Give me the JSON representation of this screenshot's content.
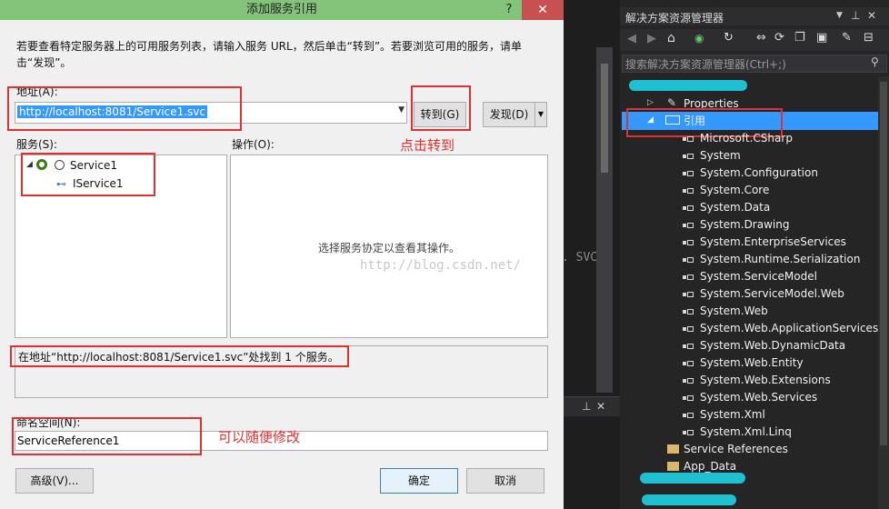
{
  "dialog": {
    "title": "添加服务引用",
    "help": "?",
    "close": "✕",
    "instruction": "若要查看特定服务器上的可用服务列表，请输入服务 URL，然后单击“转到”。若要浏览可用的服务，请单击“发现”。",
    "address_label": "地址(A):",
    "address_value": "http://localhost:8081/Service1.svc",
    "go_button": "转到(G)",
    "discover_button": "发现(D)",
    "services_label": "服务(S):",
    "operations_label": "操作(O):",
    "services_tree": [
      {
        "label": "Service1"
      },
      {
        "label": "IService1"
      }
    ],
    "operations_placeholder": "选择服务协定以查看其操作。",
    "watermark": "http://blog.csdn.net/",
    "status": "在地址“http://localhost:8081/Service1.svc”处找到 1 个服务。",
    "namespace_label": "命名空间(N):",
    "namespace_value": "ServiceReference1",
    "advanced_button": "高级(V)...",
    "ok_button": "确定",
    "cancel_button": "取消"
  },
  "annotations": {
    "click_go": "点击转到",
    "modify_freely": "可以随便修改"
  },
  "editor_fragment": ". SVC",
  "solution_explorer": {
    "title": "解决方案资源管理器",
    "search_placeholder": "搜索解决方案资源管理器(Ctrl+;)",
    "properties": "Properties",
    "references_node": "引用",
    "references": [
      "Microsoft.CSharp",
      "System",
      "System.Configuration",
      "System.Core",
      "System.Data",
      "System.Drawing",
      "System.EnterpriseServices",
      "System.Runtime.Serialization",
      "System.ServiceModel",
      "System.ServiceModel.Web",
      "System.Web",
      "System.Web.ApplicationServices",
      "System.Web.DynamicData",
      "System.Web.Entity",
      "System.Web.Extensions",
      "System.Web.Services",
      "System.Xml",
      "System.Xml.Linq"
    ],
    "service_references": "Service References",
    "app_data": "App_Data"
  },
  "colors": {
    "titlebar": "#83c37a",
    "annotation": "#e03030",
    "selection": "#3399ff",
    "se_background": "#252526"
  }
}
